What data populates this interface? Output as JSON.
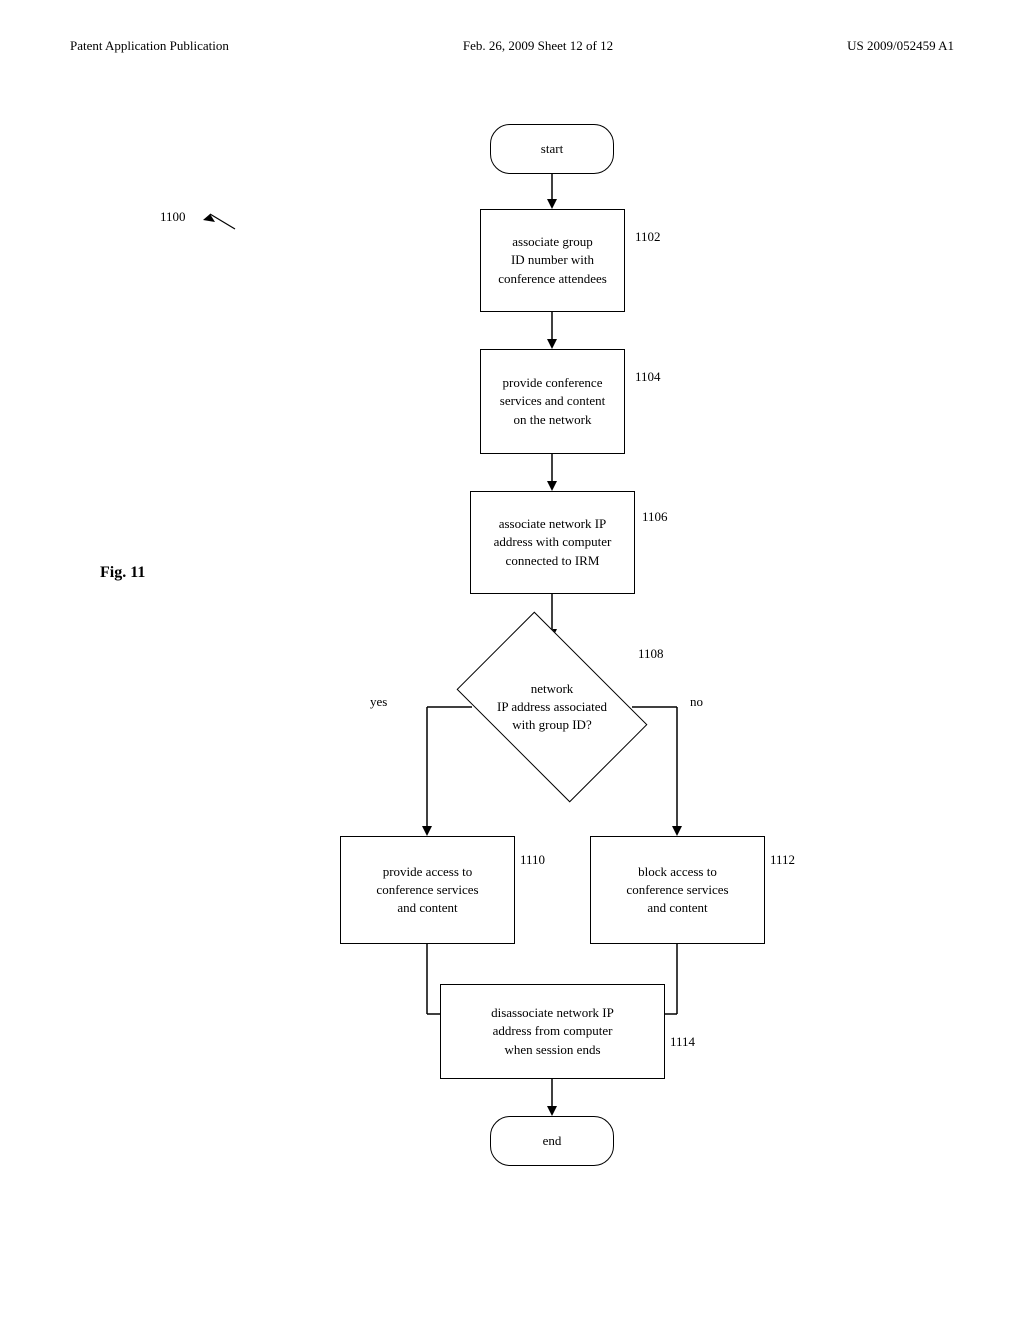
{
  "header": {
    "left": "Patent Application Publication",
    "center": "Feb. 26, 2009  Sheet 12 of 12",
    "right": "US 2009/052459 A1"
  },
  "fig_label": "Fig. 11",
  "diagram_label": "1100",
  "nodes": {
    "start": {
      "label": "start",
      "id": "start"
    },
    "n1102": {
      "label": "associate group\nID number with\nconference attendees",
      "id": "1102",
      "ref": "1102"
    },
    "n1104": {
      "label": "provide conference\nservices and content\non the network",
      "id": "1104",
      "ref": "1104"
    },
    "n1106": {
      "label": "associate network IP\naddress with computer\nconnected to IRM",
      "id": "1106",
      "ref": "1106"
    },
    "n1108": {
      "label": "network\nIP address associated\nwith group ID?",
      "id": "1108",
      "ref": "1108"
    },
    "n1110": {
      "label": "provide access to\nconference services\nand content",
      "id": "1110",
      "ref": "1110"
    },
    "n1112": {
      "label": "block access to\nconference services\nand content",
      "id": "1112",
      "ref": "1112"
    },
    "n1114": {
      "label": "disassociate network IP\naddress from computer\nwhen session ends",
      "id": "1114",
      "ref": "1114"
    },
    "end": {
      "label": "end",
      "id": "end"
    }
  },
  "branch_labels": {
    "yes": "yes",
    "no": "no"
  }
}
